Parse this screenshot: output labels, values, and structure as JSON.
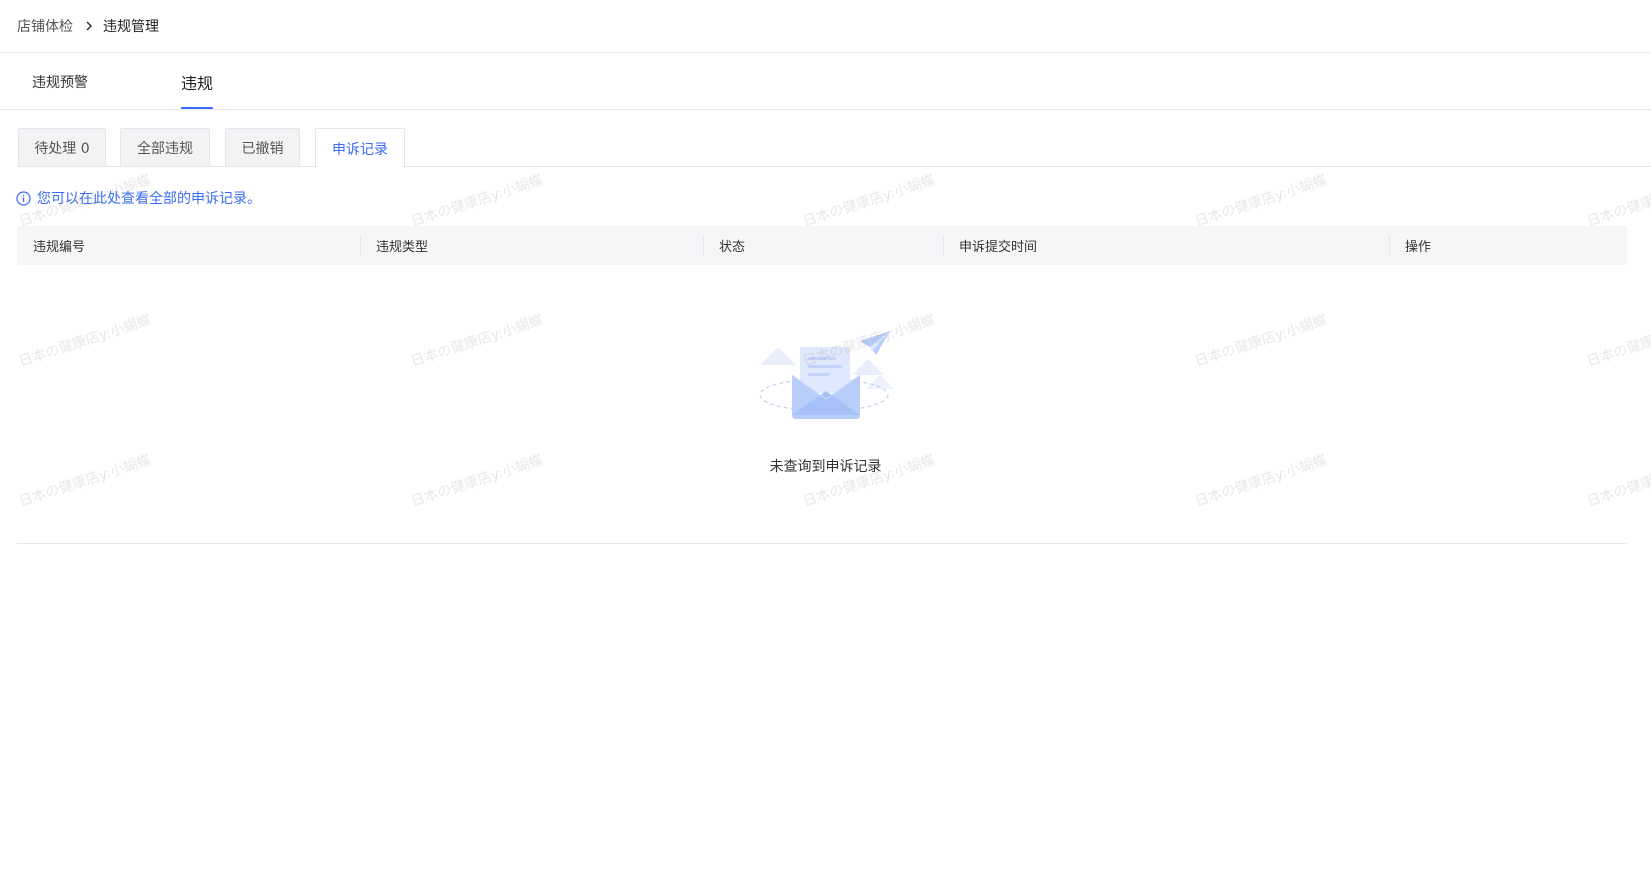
{
  "breadcrumb": {
    "parent": "店铺体检",
    "current": "违规管理"
  },
  "main_tabs": [
    {
      "label": "违规预警",
      "active": false
    },
    {
      "label": "违规",
      "active": true
    }
  ],
  "sub_tabs": [
    {
      "label": "待处理 0",
      "active": false
    },
    {
      "label": "全部违规",
      "active": false
    },
    {
      "label": "已撤销",
      "active": false
    },
    {
      "label": "申诉记录",
      "active": true
    }
  ],
  "notice": {
    "icon": "info-icon",
    "text": "您可以在此处查看全部的申诉记录。"
  },
  "table": {
    "columns": [
      "违规编号",
      "违规类型",
      "状态",
      "申诉提交时间",
      "操作"
    ],
    "rows": []
  },
  "empty_state": {
    "icon": "envelope-illustration",
    "text": "未查询到申诉记录"
  },
  "watermark": "日本の健康店y:小蝴蝶",
  "colors": {
    "accent": "#3b6cf5",
    "header_bg": "#f5f6f8",
    "tab_bg": "#f2f3f5"
  }
}
